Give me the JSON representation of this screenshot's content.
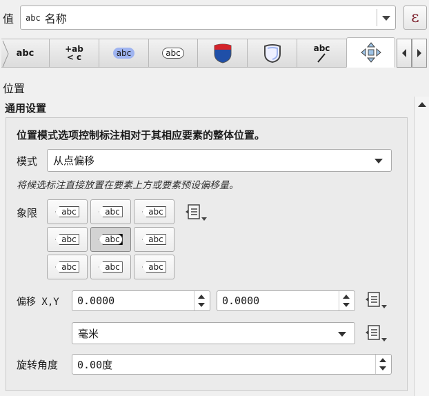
{
  "value_row": {
    "label": "值",
    "type_tag": "abc",
    "field_value": "名称",
    "expr_button": "ε"
  },
  "tabs": [
    {
      "name": "text",
      "glyph": "abc"
    },
    {
      "name": "formatting",
      "glyph_top": "+ab",
      "glyph_bottom": "< c"
    },
    {
      "name": "buffer",
      "glyph": "abc"
    },
    {
      "name": "background",
      "glyph": "abc"
    },
    {
      "name": "shadow"
    },
    {
      "name": "callouts"
    },
    {
      "name": "placement-line",
      "glyph": "abc"
    },
    {
      "name": "placement",
      "active": true
    }
  ],
  "section_title": "位置",
  "group": {
    "title": "通用设置",
    "description": "位置模式选项控制标注相对于其相应要素的整体位置。",
    "mode_label": "模式",
    "mode_value": "从点偏移",
    "mode_hint": "将候选标注直接放置在要素上方或要素预设偏移量。",
    "quadrant_label": "象限",
    "quadrant_text": "abc",
    "quadrants": [
      {
        "name": "top-left",
        "selected": false
      },
      {
        "name": "top",
        "selected": false
      },
      {
        "name": "top-right",
        "selected": false
      },
      {
        "name": "left",
        "selected": false
      },
      {
        "name": "over",
        "selected": true
      },
      {
        "name": "right",
        "selected": false
      },
      {
        "name": "bottom-left",
        "selected": false
      },
      {
        "name": "bottom",
        "selected": false
      },
      {
        "name": "bottom-right",
        "selected": false
      }
    ],
    "offset_label": "偏移 X,Y",
    "offset_x": "0.0000",
    "offset_y": "0.0000",
    "unit_value": "毫米",
    "rotation_label": "旋转角度",
    "rotation_value": "0.00度"
  },
  "colors": {
    "buffer_highlight": "#9fb4f0",
    "shield_red": "#d3232a",
    "shield_blue": "#1f4fa8"
  }
}
